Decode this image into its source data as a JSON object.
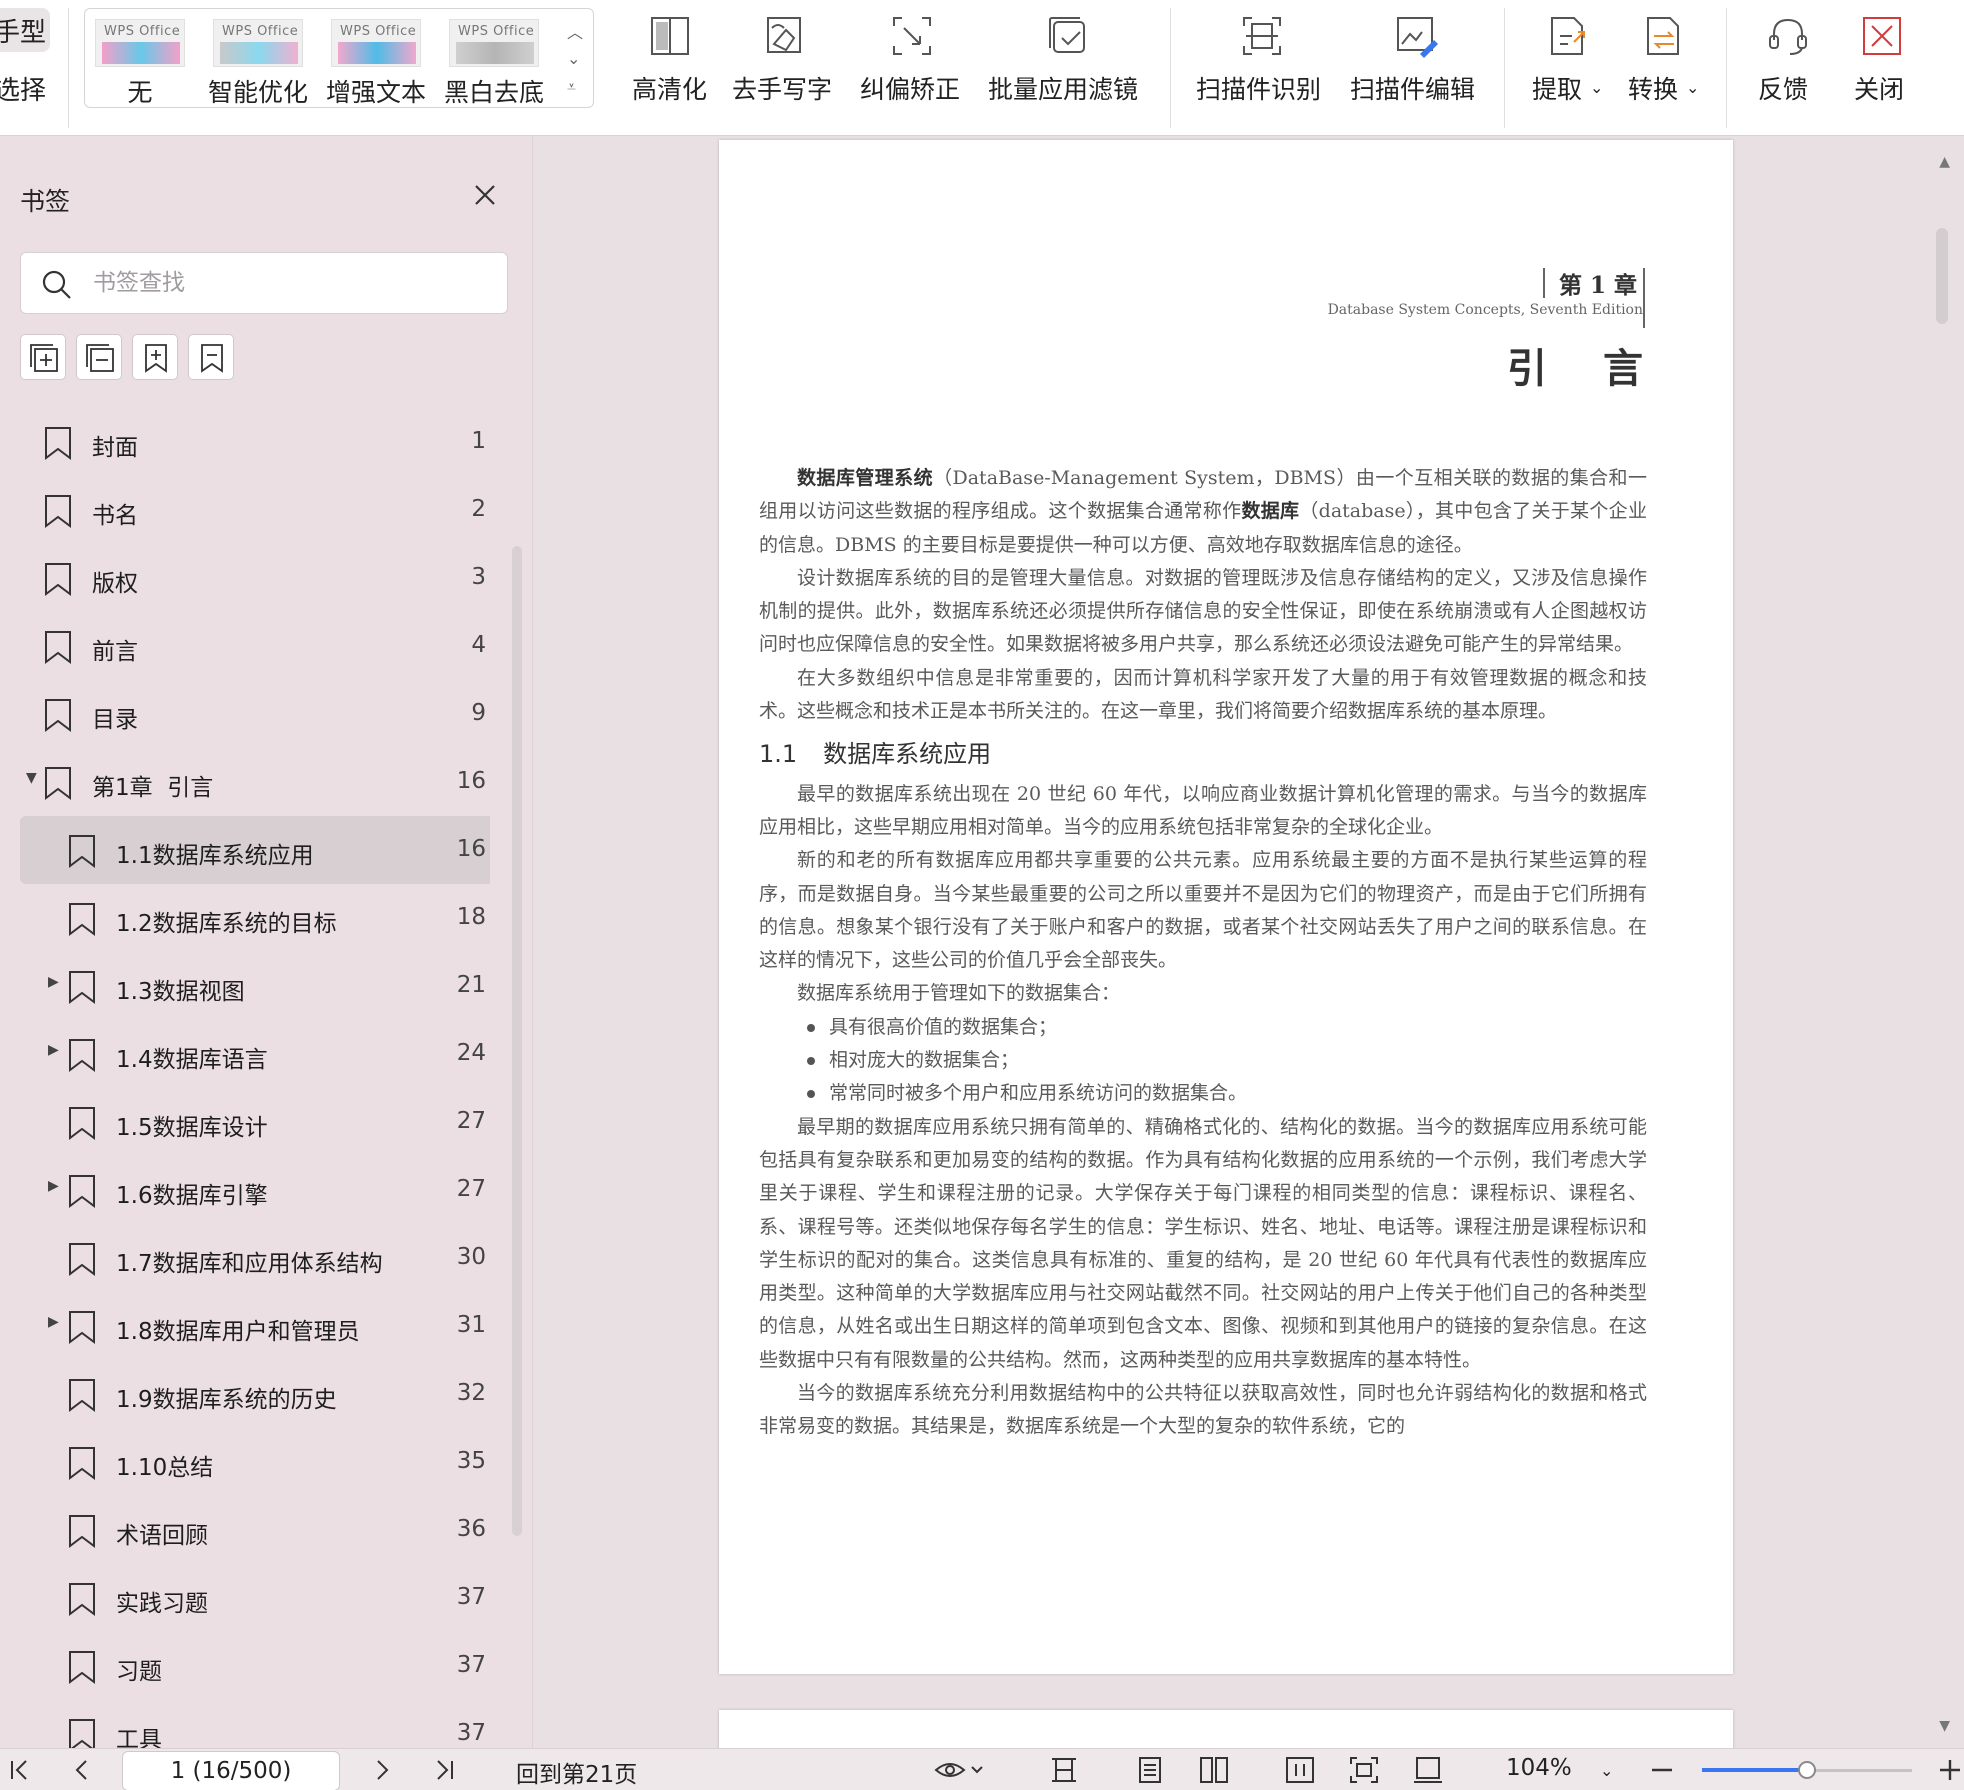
{
  "toolbar": {
    "cut_top": "手型",
    "cut_bottom": "选择",
    "filters": [
      {
        "label": "无",
        "logo": "WPS Office"
      },
      {
        "label": "智能优化",
        "logo": "WPS Office"
      },
      {
        "label": "增强文本",
        "logo": "WPS Office"
      },
      {
        "label": "黑白去底",
        "logo": "WPS Office"
      }
    ],
    "tools": [
      {
        "label": "高清化"
      },
      {
        "label": "去手写字"
      },
      {
        "label": "纠偏矫正"
      },
      {
        "label": "批量应用滤镜"
      },
      {
        "label": "扫描件识别"
      },
      {
        "label": "扫描件编辑"
      },
      {
        "label": "提取"
      },
      {
        "label": "转换"
      },
      {
        "label": "反馈"
      },
      {
        "label": "关闭"
      }
    ]
  },
  "sidebar": {
    "title": "书签",
    "search_placeholder": "书签查找",
    "items": [
      {
        "label": "封面",
        "page": "1"
      },
      {
        "label": "书名",
        "page": "2"
      },
      {
        "label": "版权",
        "page": "3"
      },
      {
        "label": "前言",
        "page": "4"
      },
      {
        "label": "目录",
        "page": "9"
      },
      {
        "label": "第1章  引言",
        "page": "16"
      },
      {
        "label": "1.1数据库系统应用",
        "page": "16"
      },
      {
        "label": "1.2数据库系统的目标",
        "page": "18"
      },
      {
        "label": "1.3数据视图",
        "page": "21"
      },
      {
        "label": "1.4数据库语言",
        "page": "24"
      },
      {
        "label": "1.5数据库设计",
        "page": "27"
      },
      {
        "label": "1.6数据库引擎",
        "page": "27"
      },
      {
        "label": "1.7数据库和应用体系结构",
        "page": "30"
      },
      {
        "label": "1.8数据库用户和管理员",
        "page": "31"
      },
      {
        "label": "1.9数据库系统的历史",
        "page": "32"
      },
      {
        "label": "1.10总结",
        "page": "35"
      },
      {
        "label": "术语回顾",
        "page": "36"
      },
      {
        "label": "实践习题",
        "page": "37"
      },
      {
        "label": "习题",
        "page": "37"
      },
      {
        "label": "工具",
        "page": "37"
      }
    ]
  },
  "document": {
    "chapter_number": "第 1 章",
    "chapter_subtitle": "Database System Concepts, Seventh Edition",
    "chapter_title": "引言",
    "p1_b1": "数据库管理系统",
    "p1_t1": "（DataBase-Management System，DBMS）由一个互相关联的数据的集合和一组用以访问这些数据的程序组成。这个数据集合通常称作",
    "p1_b2": "数据库",
    "p1_t2": "（database），其中包含了关于某个企业的信息。DBMS 的主要目标是要提供一种可以方便、高效地存取数据库信息的途径。",
    "p2": "设计数据库系统的目的是管理大量信息。对数据的管理既涉及信息存储结构的定义，又涉及信息操作机制的提供。此外，数据库系统还必须提供所存储信息的安全性保证，即使在系统崩溃或有人企图越权访问时也应保障信息的安全性。如果数据将被多用户共享，那么系统还必须设法避免可能产生的异常结果。",
    "p3": "在大多数组织中信息是非常重要的，因而计算机科学家开发了大量的用于有效管理数据的概念和技术。这些概念和技术正是本书所关注的。在这一章里，我们将简要介绍数据库系统的基本原理。",
    "section_num": "1.1",
    "section_title": "数据库系统应用",
    "p4": "最早的数据库系统出现在 20 世纪 60 年代，以响应商业数据计算机化管理的需求。与当今的数据库应用相比，这些早期应用相对简单。当今的应用系统包括非常复杂的全球化企业。",
    "p5": "新的和老的所有数据库应用都共享重要的公共元素。应用系统最主要的方面不是执行某些运算的程序，而是数据自身。当今某些最重要的公司之所以重要并不是因为它们的物理资产，而是由于它们所拥有的信息。想象某个银行没有了关于账户和客户的数据，或者某个社交网站丢失了用户之间的联系信息。在这样的情况下，这些公司的价值几乎会全部丧失。",
    "p6": "数据库系统用于管理如下的数据集合：",
    "bullets": [
      "具有很高价值的数据集合；",
      "相对庞大的数据集合；",
      "常常同时被多个用户和应用系统访问的数据集合。"
    ],
    "p7": "最早期的数据库应用系统只拥有简单的、精确格式化的、结构化的数据。当今的数据库应用系统可能包括具有复杂联系和更加易变的结构的数据。作为具有结构化数据的应用系统的一个示例，我们考虑大学里关于课程、学生和课程注册的记录。大学保存关于每门课程的相同类型的信息：课程标识、课程名、系、课程号等。还类似地保存每名学生的信息：学生标识、姓名、地址、电话等。课程注册是课程标识和学生标识的配对的集合。这类信息具有标准的、重复的结构，是 20 世纪 60 年代具有代表性的数据库应用类型。这种简单的大学数据库应用与社交网站截然不同。社交网站的用户上传关于他们自己的各种类型的信息，从姓名或出生日期这样的简单项到包含文本、图像、视频和到其他用户的链接的复杂信息。在这些数据中只有有限数量的公共结构。然而，这两种类型的应用共享数据库的基本特性。",
    "p8": "当今的数据库系统充分利用数据结构中的公共特征以获取高效性，同时也允许弱结构化的数据和格式非常易变的数据。其结果是，数据库系统是一个大型的复杂的软件系统，它的"
  },
  "status": {
    "page_indicator": "1 (16/500)",
    "back_to_page": "回到第21页",
    "zoom": "104%",
    "zoom_fraction": 0.5
  },
  "colors": {
    "accent": "#3a76f0",
    "sidebar_bg": "#ecdfe3",
    "active_item": "#d7cfd2"
  }
}
